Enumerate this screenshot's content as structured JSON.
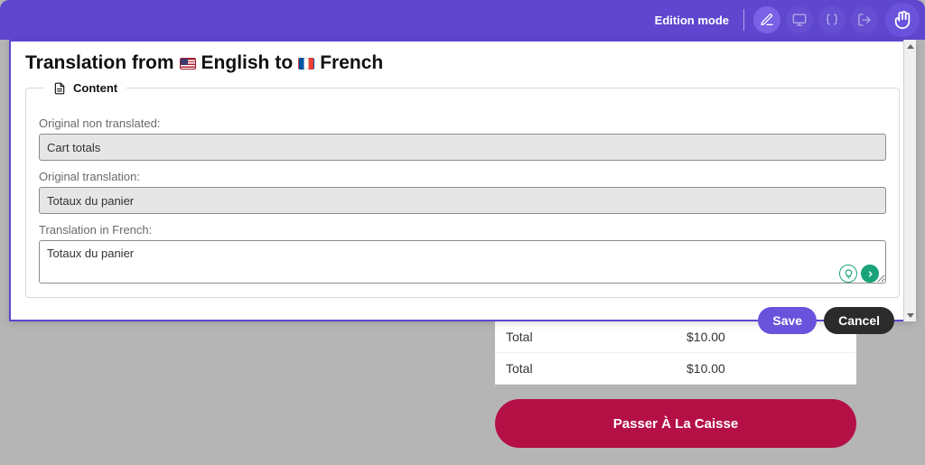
{
  "topbar": {
    "mode_label": "Edition mode"
  },
  "modal": {
    "title_prefix": "Translation from",
    "src_lang": "English",
    "to_word": "to",
    "dst_lang": "French",
    "content_legend": "Content",
    "labels": {
      "original_non_translated": "Original non translated:",
      "original_translation": "Original translation:",
      "translation_in_dst": "Translation in French:"
    },
    "values": {
      "original_non_translated": "Cart totals",
      "original_translation": "Totaux du panier",
      "translation_in_dst": "Totaux du panier"
    },
    "actions": {
      "save": "Save",
      "cancel": "Cancel"
    }
  },
  "under": {
    "rows": [
      {
        "label": "Total",
        "value": "$10.00"
      },
      {
        "label": "Total",
        "value": "$10.00"
      }
    ],
    "checkout_label": "Passer À La Caisse"
  }
}
